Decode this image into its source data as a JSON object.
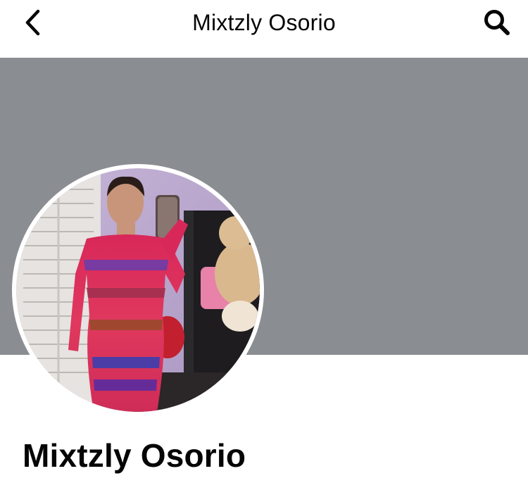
{
  "header": {
    "title": "Mixtzly Osorio",
    "back_icon": "chevron-left-icon",
    "search_icon": "search-icon"
  },
  "cover": {
    "color": "#8a8d91"
  },
  "profile": {
    "name": "Mixtzly Osorio",
    "avatar_description_icon": "profile-photo"
  },
  "colors": {
    "text": "#050505",
    "cover_gray": "#8a8d91",
    "background": "#ffffff"
  }
}
